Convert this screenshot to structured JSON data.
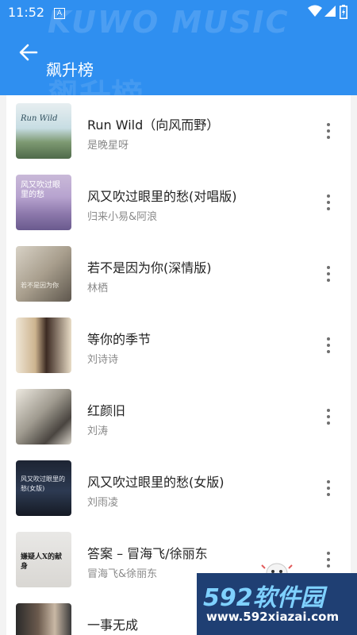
{
  "status_bar": {
    "time": "11:52",
    "notification_letter": "A"
  },
  "header": {
    "title": "飙升榜",
    "watermark": "KUWO MUSIC",
    "watermark_hanzi": "飙升榜"
  },
  "songs": [
    {
      "title": "Run Wild（向风而野）",
      "artist": "是晚星呀",
      "cover_text": "Run Wild"
    },
    {
      "title": "风又吹过眼里的愁(对唱版)",
      "artist": "归来小易&阿浪",
      "cover_text": "风又吹过眼里的愁"
    },
    {
      "title": "若不是因为你(深情版)",
      "artist": "林栖",
      "cover_text": "若不是因为你"
    },
    {
      "title": "等你的季节",
      "artist": "刘诗诗",
      "cover_text": ""
    },
    {
      "title": "红颜旧",
      "artist": "刘涛",
      "cover_text": ""
    },
    {
      "title": "风又吹过眼里的愁(女版)",
      "artist": "刘雨凌",
      "cover_text": "风又吹过眼里的愁(女版)"
    },
    {
      "title": "答案 – 冒海飞/徐丽东",
      "artist": "冒海飞&徐丽东",
      "cover_text": "嫌疑人X的献身"
    },
    {
      "title": "一事无成",
      "artist": "",
      "cover_text": ""
    }
  ],
  "site_watermark": {
    "main": "592软件园",
    "url": "www.592xiazai.com"
  },
  "colors": {
    "header": "#2f8ff0",
    "list_bg": "#f3f3f3",
    "artist": "#8a8a8a"
  }
}
